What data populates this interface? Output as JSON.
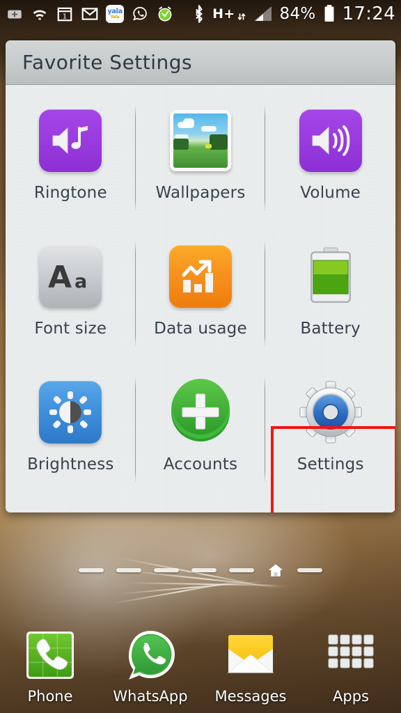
{
  "status_bar": {
    "left_icons": [
      {
        "name": "more-notifications-icon",
        "glyph": "+"
      },
      {
        "name": "wifi-question-icon",
        "glyph": "wifi"
      },
      {
        "name": "calendar-icon",
        "glyph": "1"
      },
      {
        "name": "gmail-icon",
        "glyph": "M"
      },
      {
        "name": "yala-app-icon",
        "glyph": "yala"
      },
      {
        "name": "whatsapp-notification-icon",
        "glyph": "phone-bubble"
      },
      {
        "name": "alarm-clock-icon",
        "glyph": "alarm"
      }
    ],
    "yala_label_top": "yala",
    "yala_label_bottom": "Yala",
    "calendar_day": "1",
    "gmail_letter": "M",
    "bluetooth": "bluetooth-icon",
    "network_type": "H+",
    "signal": "signal-bars-icon",
    "battery_percent": "84%",
    "battery_icon": "battery-icon",
    "clock": "17:24"
  },
  "panel": {
    "title": "Favorite Settings",
    "items": [
      {
        "label": "Ringtone",
        "icon": "ringtone-icon",
        "style": "purple"
      },
      {
        "label": "Wallpapers",
        "icon": "wallpapers-icon",
        "style": "photo"
      },
      {
        "label": "Volume",
        "icon": "volume-icon",
        "style": "purple"
      },
      {
        "label": "Font size",
        "icon": "font-size-icon",
        "style": "silver",
        "glyph": "Aa"
      },
      {
        "label": "Data usage",
        "icon": "data-usage-icon",
        "style": "orange"
      },
      {
        "label": "Battery",
        "icon": "battery-level-icon",
        "style": "plain"
      },
      {
        "label": "Brightness",
        "icon": "brightness-icon",
        "style": "blue"
      },
      {
        "label": "Accounts",
        "icon": "accounts-icon",
        "style": "plain"
      },
      {
        "label": "Settings",
        "icon": "settings-gear-icon",
        "style": "plain"
      }
    ],
    "highlighted_item": "Settings",
    "highlight_color": "#f41414"
  },
  "page_indicator": {
    "pages": 7,
    "home_index": 5,
    "home_icon": "home-icon"
  },
  "dock": {
    "items": [
      {
        "label": "Phone",
        "icon": "phone-icon"
      },
      {
        "label": "WhatsApp",
        "icon": "whatsapp-icon"
      },
      {
        "label": "Messages",
        "icon": "messages-envelope-icon"
      },
      {
        "label": "Apps",
        "icon": "apps-grid-icon"
      }
    ]
  },
  "colors": {
    "accent_purple": "#9a3ce0",
    "accent_orange": "#f7921e",
    "accent_blue": "#3d8fdc",
    "accent_green": "#3fae3f",
    "highlight_red": "#f41414",
    "panel_bg": "#e6eaea",
    "label_text": "#38424e"
  }
}
